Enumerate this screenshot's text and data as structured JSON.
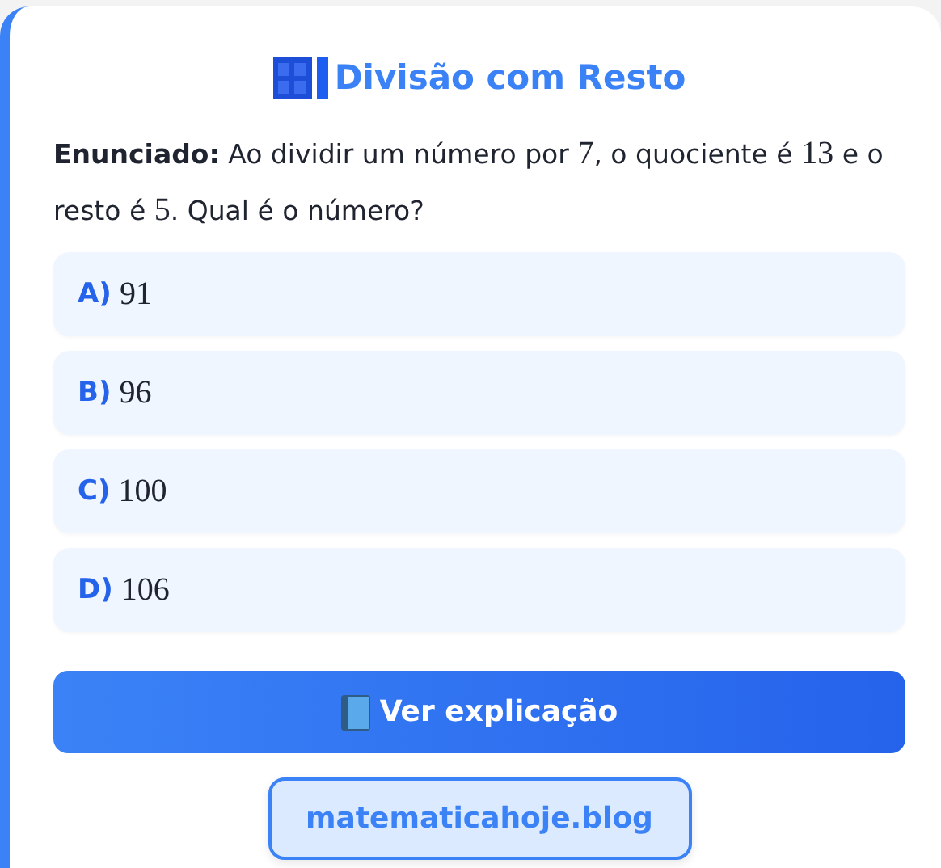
{
  "title": "Divisão com Resto",
  "statement": [
    {
      "kind": "bold",
      "text": "Enunciado:"
    },
    {
      "kind": "text",
      "text": " Ao dividir um número por "
    },
    {
      "kind": "math",
      "text": "7"
    },
    {
      "kind": "text",
      "text": ", o quociente é "
    },
    {
      "kind": "math",
      "text": "13"
    },
    {
      "kind": "text",
      "text": " e o resto é "
    },
    {
      "kind": "math",
      "text": "5"
    },
    {
      "kind": "text",
      "text": ". Qual é o número?"
    }
  ],
  "options": [
    {
      "letter": "A)",
      "value": "91"
    },
    {
      "letter": "B)",
      "value": "96"
    },
    {
      "letter": "C)",
      "value": "100"
    },
    {
      "letter": "D)",
      "value": "106"
    }
  ],
  "explain_button": "Ver explicação",
  "site_link": "matematicahoje.blog"
}
